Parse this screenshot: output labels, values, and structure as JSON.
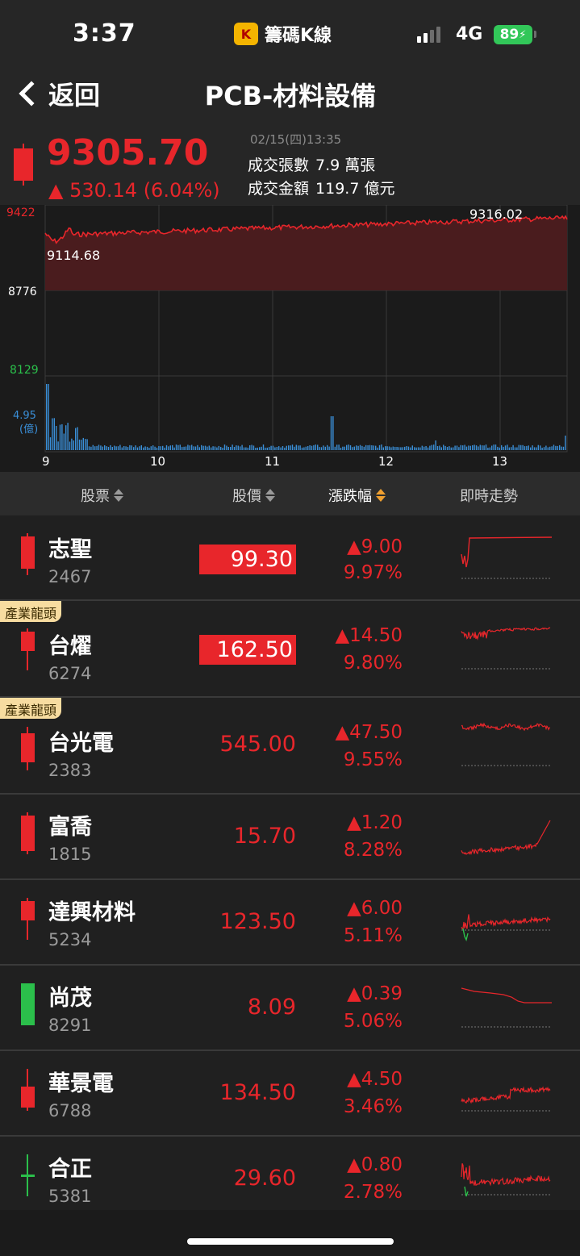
{
  "status_bar": {
    "time": "3:37",
    "app_name": "籌碼K線",
    "network": "4G",
    "battery": "89"
  },
  "nav": {
    "back_label": "返回",
    "title": "PCB-材料設備"
  },
  "quote": {
    "price": "9305.70",
    "change": "▲ 530.14 (6.04%)",
    "datetime": "02/15(四)13:35",
    "volume_label": "成交張數",
    "volume_value": "7.9 萬張",
    "amount_label": "成交金額",
    "amount_value": "119.7 億元"
  },
  "chart_data": {
    "type": "line",
    "y_ticks": [
      "9422",
      "8776",
      "8129"
    ],
    "ylim": [
      8129,
      9422
    ],
    "reference": 8776,
    "high_label": "9316.02",
    "low_label": "9114.68",
    "volume_max_label": "4.95",
    "volume_unit": "(億)",
    "x_ticks": [
      "9",
      "10",
      "11",
      "12",
      "13"
    ],
    "colors": {
      "up": "#e8262b",
      "down": "#2bbf4b",
      "volume": "#3a8fd8",
      "fill": "#4a1c1e"
    }
  },
  "list_header": {
    "col_stock": "股票",
    "col_price": "股價",
    "col_change": "漲跌幅",
    "col_trend": "即時走勢"
  },
  "stocks": [
    {
      "name": "志聖",
      "code": "2467",
      "price": "99.30",
      "change": "▲9.00",
      "pct": "9.97%",
      "tag": ""
    },
    {
      "name": "台燿",
      "code": "6274",
      "price": "162.50",
      "change": "▲14.50",
      "pct": "9.80%",
      "tag": "產業龍頭"
    },
    {
      "name": "台光電",
      "code": "2383",
      "price": "545.00",
      "change": "▲47.50",
      "pct": "9.55%",
      "tag": "產業龍頭"
    },
    {
      "name": "富喬",
      "code": "1815",
      "price": "15.70",
      "change": "▲1.20",
      "pct": "8.28%",
      "tag": ""
    },
    {
      "name": "達興材料",
      "code": "5234",
      "price": "123.50",
      "change": "▲6.00",
      "pct": "5.11%",
      "tag": ""
    },
    {
      "name": "尚茂",
      "code": "8291",
      "price": "8.09",
      "change": "▲0.39",
      "pct": "5.06%",
      "tag": ""
    },
    {
      "name": "華景電",
      "code": "6788",
      "price": "134.50",
      "change": "▲4.50",
      "pct": "3.46%",
      "tag": ""
    },
    {
      "name": "合正",
      "code": "5381",
      "price": "29.60",
      "change": "▲0.80",
      "pct": "2.78%",
      "tag": ""
    }
  ]
}
